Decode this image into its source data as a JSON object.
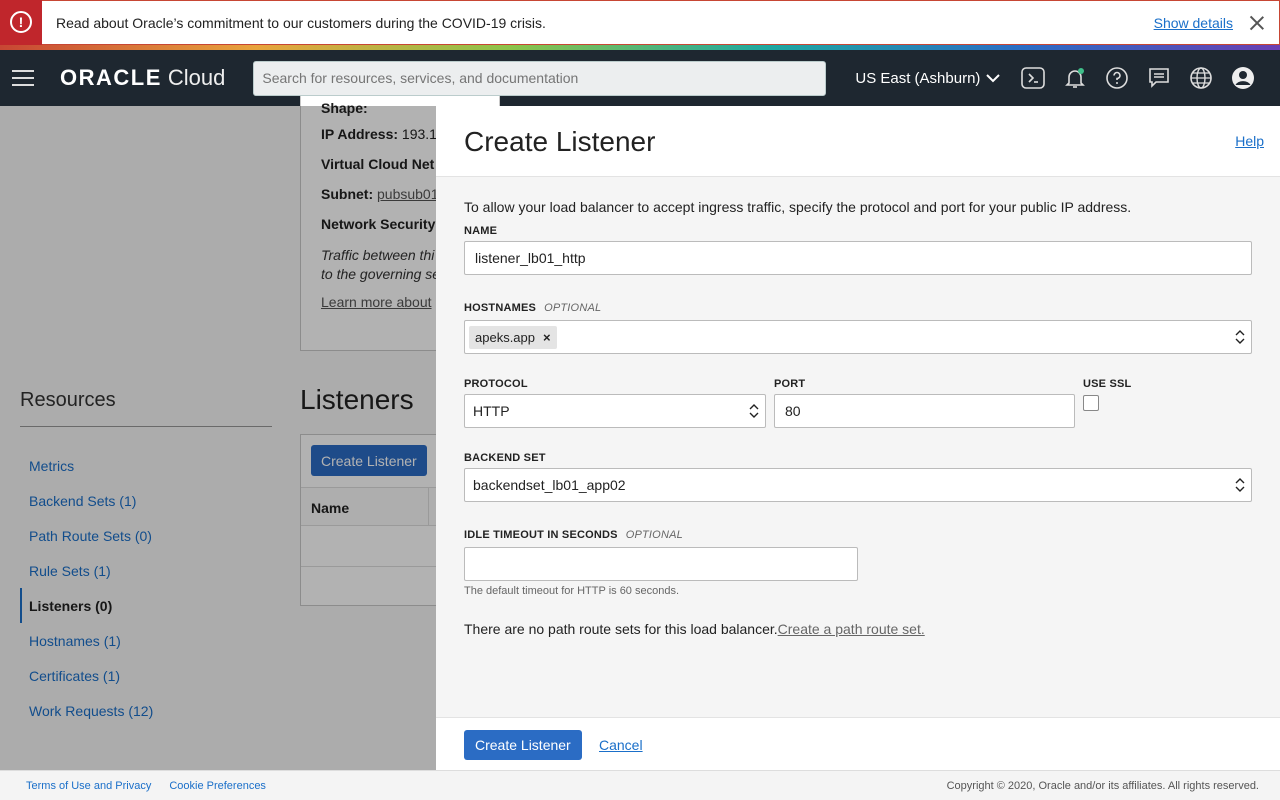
{
  "alert": {
    "message": "Read about Oracle’s commitment to our customers during the COVID-19 crisis.",
    "link": "Show details"
  },
  "nav": {
    "brand_oracle": "ORACLE",
    "brand_cloud": "Cloud",
    "search_placeholder": "Search for resources, services, and documentation",
    "region": "US East (Ashburn)"
  },
  "background": {
    "details": {
      "shape_label": "Shape:",
      "ip_label": "IP Address:",
      "ip_value": "193.1",
      "vcn_label": "Virtual Cloud Net",
      "subnet_label": "Subnet:",
      "subnet_value": "pubsub01",
      "nsg_label": "Network Security",
      "traffic_line1": "Traffic between thi",
      "traffic_line2": "to the governing se",
      "learn_more": "Learn more about"
    },
    "resources_title": "Resources",
    "resources": [
      {
        "label": "Metrics"
      },
      {
        "label": "Backend Sets (1)"
      },
      {
        "label": "Path Route Sets (0)"
      },
      {
        "label": "Rule Sets (1)"
      },
      {
        "label": "Listeners (0)"
      },
      {
        "label": "Hostnames (1)"
      },
      {
        "label": "Certificates (1)"
      },
      {
        "label": "Work Requests (12)"
      }
    ],
    "listeners_title": "Listeners",
    "create_button": "Create Listener",
    "table_header_name": "Name"
  },
  "panel": {
    "title": "Create Listener",
    "help": "Help",
    "intro": "To allow your load balancer to accept ingress traffic, specify the protocol and port for your public IP address.",
    "name_label": "NAME",
    "name_value": "listener_lb01_http",
    "hostnames_label": "HOSTNAMES",
    "optional": "OPTIONAL",
    "hostname_tag": "apeks.app",
    "protocol_label": "PROTOCOL",
    "protocol_value": "HTTP",
    "port_label": "PORT",
    "port_value": "80",
    "ssl_label": "USE SSL",
    "backend_label": "BACKEND SET",
    "backend_value": "backendset_lb01_app02",
    "idle_label": "IDLE TIMEOUT IN SECONDS",
    "idle_value": "",
    "idle_hint": "The default timeout for HTTP is 60 seconds.",
    "routes_text": "There are no path route sets for this load balancer.",
    "routes_link": "Create a path route set.",
    "submit": "Create Listener",
    "cancel": "Cancel"
  },
  "footer": {
    "terms": "Terms of Use and Privacy",
    "cookies": "Cookie Preferences",
    "copyright": "Copyright © 2020, Oracle and/or its affiliates. All rights reserved."
  }
}
